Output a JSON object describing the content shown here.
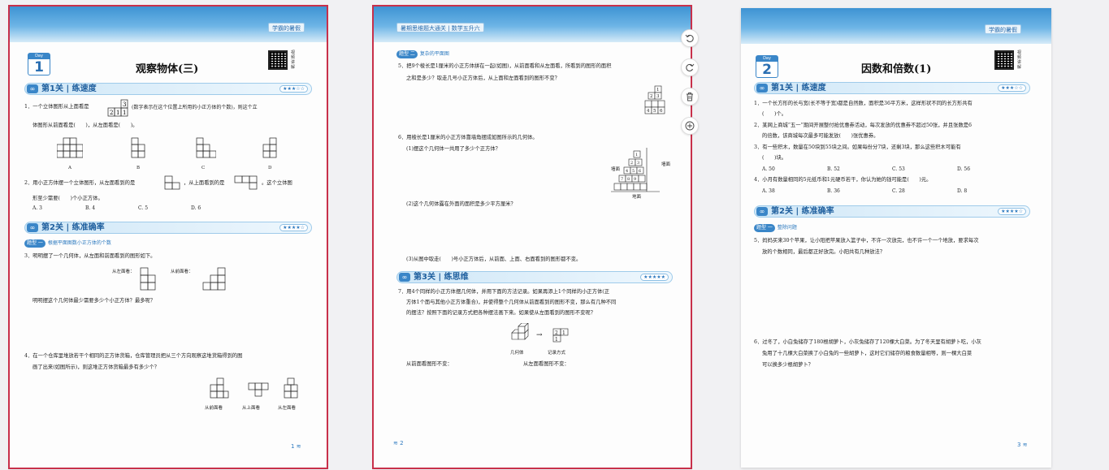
{
  "pages": [
    {
      "banner_tag": "学霸的暑假",
      "day_label": "Day",
      "day_num": "1",
      "title": "观察物体(三)",
      "qr_note": "视频讲解",
      "sections": [
        {
          "num_text": "第1关",
          "name": "练速度",
          "stars": "★★★☆☆"
        },
        {
          "num_text": "第2关",
          "name": "练准确率",
          "stars": "★★★★☆"
        }
      ],
      "subsection": {
        "tag": "题型 一",
        "text": "根据平面图数小正方体的个数"
      },
      "questions": [
        "1．一个立体图形从上面看是",
        "(数字表示在这个位置上所用的小正方体的个数)，则这个立",
        "体图形从前面看是(　　)，从左面看是(　　)。",
        "2．用小正方体摆一个立体图形，从左面看到的是",
        "，从上面看到的是",
        "。这个立体图",
        "形至少需要(　　)个小正方体。",
        "3．明明摆了一个几何体，从左面和前面看到的图形如下。",
        "明明摆这个几何体最少需要多少个小正方体？最多呢？",
        "4．在一个仓库里堆放若干个相同的正方体货箱，仓库管理员把从三个方向观察这堆货箱得到的图",
        "画了出来(如图所示)，则这堆正方体货箱最多有多少个？"
      ],
      "q1_options": [
        "A",
        "B",
        "C",
        "D"
      ],
      "q2_options": [
        "A. 3",
        "B. 4",
        "C. 5",
        "D. 6"
      ],
      "q3_labels": [
        "从左面看：",
        "从前面看："
      ],
      "q4_labels": [
        "从前面看",
        "从上面看",
        "从左面看"
      ],
      "q1_top_digits": [
        "3",
        "2",
        "1",
        "1"
      ],
      "page_no": "1"
    },
    {
      "banner_tag": "暑期思维题大通关 | 数学五升六",
      "subsection": {
        "tag": "题型 二",
        "text": "复杂的平面图"
      },
      "section": {
        "num_text": "第3关",
        "name": "练思维",
        "stars": "★★★★★"
      },
      "questions": [
        "5．把9个棱长是1厘米的小正方体拼在一起(如图)，从前面看和从左面看，所看到的图形的面积",
        "之和是多少？取走几号小正方体后，从上面和左面看到的图形不变？",
        "6．用棱长是1厘米的小正方体靠墙角摆成如图所示的几何体。",
        "(1)摆这个几何体一共用了多少个正方体？",
        "(2)这个几何体露在外面的面积是多少平方厘米？",
        "(3)从图中取走(　　)号小正方体后，从前面、上面、右面看到的图形都不变。",
        "7．用4个同样的小正方体摆几何体，并用下面的方法记录。如果再添上1个同样的小正方体(正",
        "方体1个面与其他小正方体重合)，并使得整个几何体从前面看到的图形不变，那么有几种不同",
        "的摆法？按照下面的记录方式把各种摆法画下来。如果使从左面看到的图形不变呢？",
        "从前面看图形不变：",
        "从左面看图形不变："
      ],
      "q5_digits": [
        "1",
        "2",
        "3",
        "4",
        "5",
        "6"
      ],
      "q6_labels": [
        "墙面",
        "墙面",
        "地面"
      ],
      "q6_digits": [
        "1",
        "2",
        "3",
        "4",
        "5",
        "6",
        "7",
        "8",
        "9"
      ],
      "q7_labels": [
        "几何体",
        "记录方式"
      ],
      "q7_record": [
        "2",
        "1",
        "1"
      ],
      "page_no": "2"
    },
    {
      "banner_tag": "学霸的暑假",
      "day_label": "Day",
      "day_num": "2",
      "title": "因数和倍数(1)",
      "qr_note": "视频讲解",
      "sections": [
        {
          "num_text": "第1关",
          "name": "练速度",
          "stars": "★★★☆☆"
        },
        {
          "num_text": "第2关",
          "name": "练准确率",
          "stars": "★★★★☆"
        }
      ],
      "subsection": {
        "tag": "题型 一",
        "text": "整除问题"
      },
      "questions": [
        "1．一个长方形的长与宽(长不等于宽)都是自然数，面积是36平方米，这样形状不同的长方形共有",
        "(　　)个。",
        "2．某网上商城“五一”期间开展整付抢优惠券活动，每次发放的优惠券不超过50张，并且张数是6",
        "的倍数，该商城每次最多可能发放(　　)张优惠券。",
        "3．有一些积木，数量在50块到55块之间。如果每份分7块，还剩3块，那么这些积木可能有",
        "(　　)块。",
        "4．小月有数量相同的5元纸币和1元硬币若干，你认为她的钱可能是(　　)元。",
        "5．妈妈买来30个苹果，让小阳把苹果放入篮子中，不许一次放完，也不许一个一个地放，要求每次",
        "放的个数相同，最后都正好放完。小阳共有几种放法？",
        "6．过冬了，小白兔储存了180根胡萝卜，小灰兔储存了120棵大白菜。为了冬天里有胡萝卜吃，小灰",
        "兔用了十几棵大白菜换了小白兔的一些胡萝卜，这时它们储存的粮食数量相等，则一棵大白菜",
        "可以换多少根胡萝卜？"
      ],
      "q3_options": [
        "A. 50",
        "B. 52",
        "C. 53",
        "D. 56"
      ],
      "q4_options": [
        "A. 38",
        "B. 36",
        "C. 28",
        "D. 8"
      ],
      "page_no": "3"
    }
  ],
  "toolbar": {
    "rotate_left": "rotate-left-icon",
    "rotate_right": "rotate-right-icon",
    "delete": "trash-icon",
    "add": "add-page-icon"
  }
}
